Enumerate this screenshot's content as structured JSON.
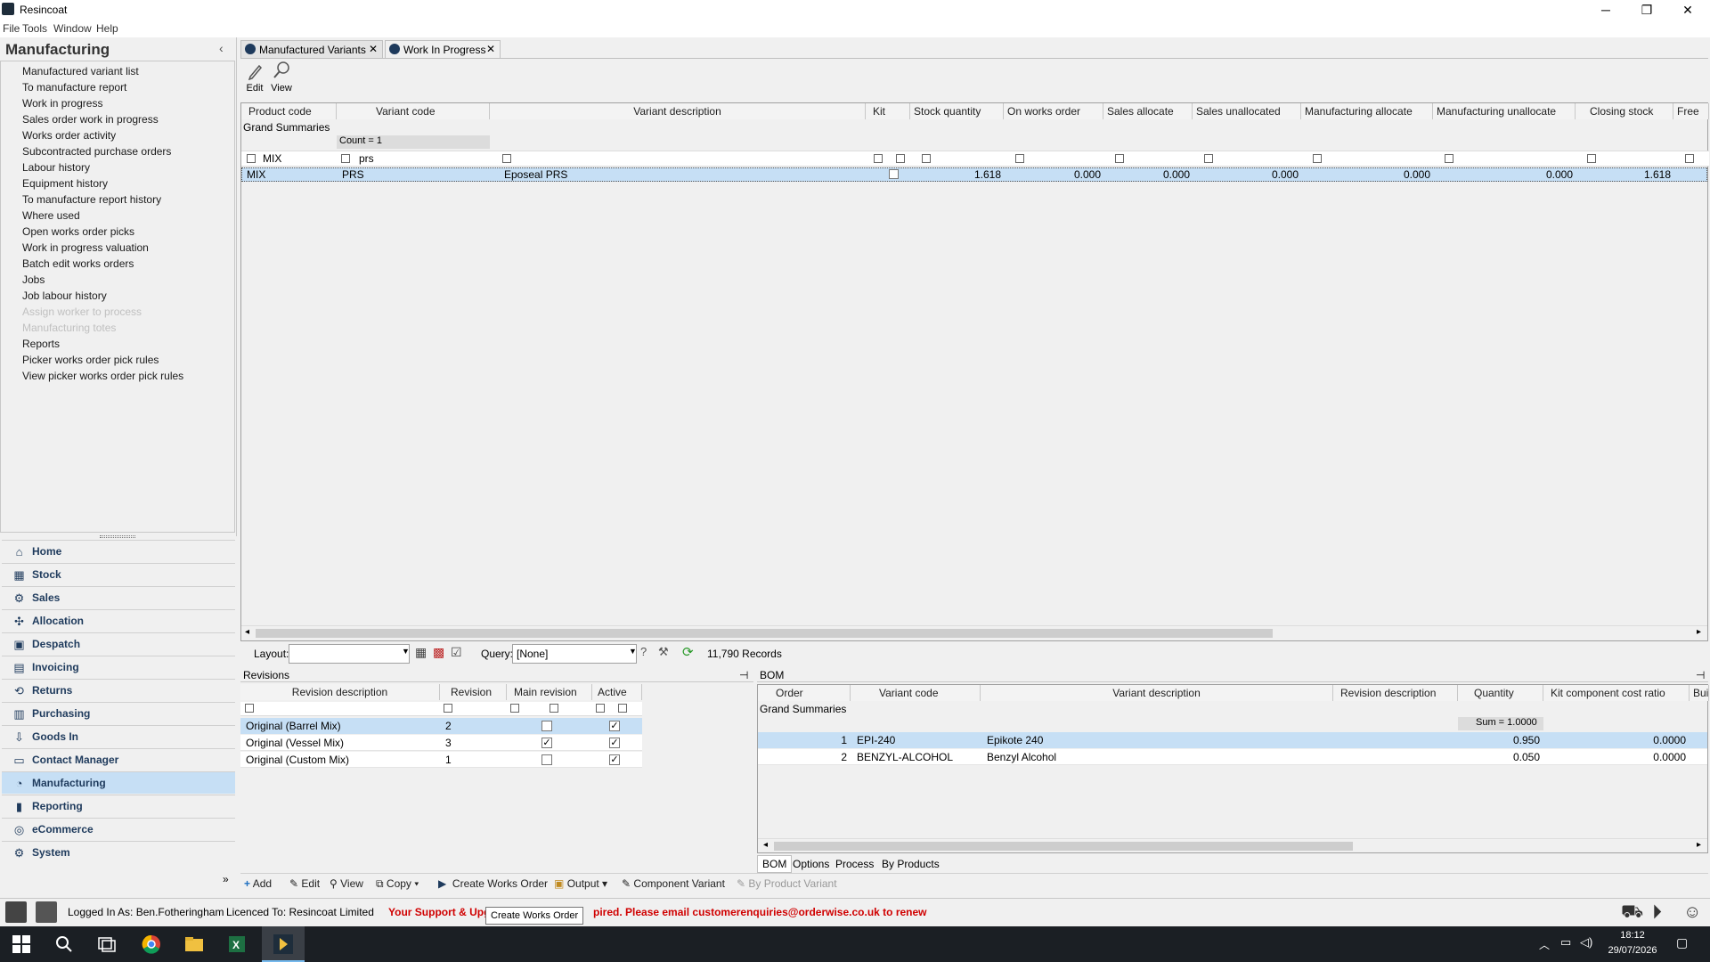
{
  "window": {
    "title": "Resincoat",
    "minimize": "─",
    "restore": "❐",
    "close": "✕"
  },
  "menu": [
    "File",
    "Tools",
    "Window",
    "Help"
  ],
  "sidebar": {
    "header": "Manufacturing",
    "collapse": "‹",
    "links": [
      {
        "label": "Manufactured variant list",
        "enabled": true
      },
      {
        "label": "To manufacture report",
        "enabled": true
      },
      {
        "label": "Work in progress",
        "enabled": true
      },
      {
        "label": "Sales order work in progress",
        "enabled": true
      },
      {
        "label": "Works order activity",
        "enabled": true
      },
      {
        "label": "Subcontracted purchase orders",
        "enabled": true
      },
      {
        "label": "Labour history",
        "enabled": true
      },
      {
        "label": "Equipment history",
        "enabled": true
      },
      {
        "label": "To manufacture report history",
        "enabled": true
      },
      {
        "label": "Where used",
        "enabled": true
      },
      {
        "label": "Open works order picks",
        "enabled": true
      },
      {
        "label": "Work in progress valuation",
        "enabled": true
      },
      {
        "label": "Batch edit works orders",
        "enabled": true
      },
      {
        "label": "Jobs",
        "enabled": true
      },
      {
        "label": "Job labour history",
        "enabled": true
      },
      {
        "label": "Assign worker to process",
        "enabled": false
      },
      {
        "label": "Manufacturing totes",
        "enabled": false
      },
      {
        "label": "Reports",
        "enabled": true
      },
      {
        "label": "Picker works order pick rules",
        "enabled": true
      },
      {
        "label": "View picker works order pick rules",
        "enabled": true
      }
    ],
    "modules": [
      {
        "label": "Home",
        "icon": "home-icon",
        "glyph": "⌂"
      },
      {
        "label": "Stock",
        "icon": "stock-icon",
        "glyph": "▦"
      },
      {
        "label": "Sales",
        "icon": "sales-icon",
        "glyph": "⚙"
      },
      {
        "label": "Allocation",
        "icon": "allocation-icon",
        "glyph": "✣"
      },
      {
        "label": "Despatch",
        "icon": "despatch-icon",
        "glyph": "▣"
      },
      {
        "label": "Invoicing",
        "icon": "invoicing-icon",
        "glyph": "▤"
      },
      {
        "label": "Returns",
        "icon": "returns-icon",
        "glyph": "⟲"
      },
      {
        "label": "Purchasing",
        "icon": "purchasing-icon",
        "glyph": "▥"
      },
      {
        "label": "Goods In",
        "icon": "goods-in-icon",
        "glyph": "⇩"
      },
      {
        "label": "Contact Manager",
        "icon": "contact-manager-icon",
        "glyph": "▭"
      },
      {
        "label": "Manufacturing",
        "icon": "manufacturing-icon",
        "glyph": "◔",
        "active": true
      },
      {
        "label": "Reporting",
        "icon": "reporting-icon",
        "glyph": "▮"
      },
      {
        "label": "eCommerce",
        "icon": "ecommerce-icon",
        "glyph": "◎"
      },
      {
        "label": "System",
        "icon": "system-icon",
        "glyph": "⚙"
      }
    ]
  },
  "tabs": [
    {
      "label": "Manufactured Variants",
      "close": "✕"
    },
    {
      "label": "Work In Progress",
      "close": "✕"
    }
  ],
  "toolbar": {
    "edit": "Edit",
    "view": "View"
  },
  "grid": {
    "columns": [
      "Product code",
      "Variant code",
      "Variant description",
      "Kit",
      "Stock quantity",
      "On works order",
      "Sales allocate",
      "Sales unallocated",
      "Manufacturing allocate",
      "Manufacturing unallocate",
      "Closing stock",
      "Free"
    ],
    "grand_summaries": "Grand Summaries",
    "count": "Count = 1",
    "filter_product": "MIX",
    "filter_variant": "prs",
    "row": {
      "product": "MIX",
      "variant": "PRS",
      "description": "Eposeal PRS",
      "stock": "1.618",
      "works": "0.000",
      "sales_alloc": "0.000",
      "sales_unalloc": "0.000",
      "mfg_alloc": "0.000",
      "mfg_unalloc": "0.000",
      "closing": "1.618"
    }
  },
  "layoutbar": {
    "layout_label": "Layout:",
    "layout_value": "",
    "query_label": "Query:",
    "query_value": "[None]",
    "records": "11,790 Records"
  },
  "revisions": {
    "title": "Revisions",
    "columns": [
      "Revision description",
      "Revision",
      "Main revision",
      "Active"
    ],
    "rows": [
      {
        "desc": "Original (Barrel Mix)",
        "rev": "2",
        "main": "",
        "active": "✓"
      },
      {
        "desc": "Original (Vessel Mix)",
        "rev": "3",
        "main": "✓",
        "active": "✓"
      },
      {
        "desc": "Original (Custom Mix)",
        "rev": "1",
        "main": "",
        "active": "✓"
      }
    ]
  },
  "bom": {
    "title": "BOM",
    "columns": [
      "Order",
      "Variant code",
      "Variant description",
      "Revision description",
      "Quantity",
      "Kit component cost ratio",
      "Bui"
    ],
    "grand_summaries": "Grand Summaries",
    "sum": "Sum = 1.0000",
    "rows": [
      {
        "order": "1",
        "code": "EPI-240",
        "desc": "Epikote 240",
        "rev": "",
        "qty": "0.950",
        "ratio": "0.0000"
      },
      {
        "order": "2",
        "code": "BENZYL-ALCOHOL",
        "desc": "Benzyl Alcohol",
        "rev": "",
        "qty": "0.050",
        "ratio": "0.0000"
      }
    ],
    "subtabs": [
      "BOM",
      "Options",
      "Process",
      "By Products"
    ]
  },
  "actions": {
    "add": "Add",
    "edit": "Edit",
    "view": "View",
    "copy": "Copy",
    "create_works_order": "Create Works Order",
    "output": "Output",
    "component_variant": "Component Variant",
    "by_product_variant": "By Product Variant"
  },
  "status": {
    "logged_in": "Logged In As: Ben.Fotheringham",
    "licenced": "Licenced To: Resincoat Limited",
    "warning_start": "Your Support & Upg",
    "warning_end": "pired. Please email customerenquiries@orderwise.co.uk to renew",
    "tooltip": "Create Works Order"
  },
  "taskbar": {
    "time": "18:12",
    "date": "29/07/2026"
  },
  "colors": {
    "accent": "#1e3a5c",
    "selected_row": "#c6dff5",
    "warning": "#d00000"
  }
}
